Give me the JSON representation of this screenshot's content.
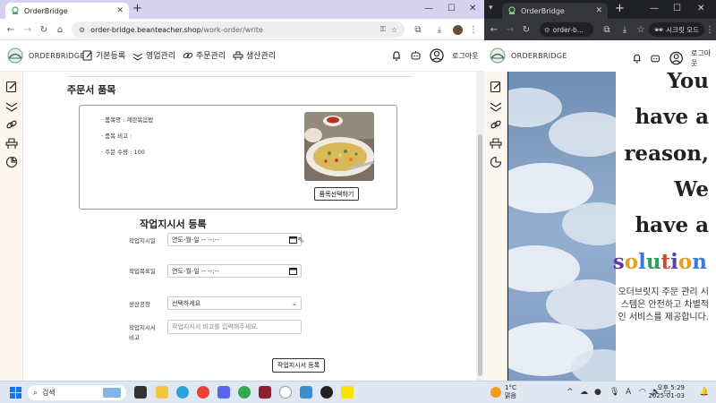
{
  "left_browser": {
    "tab_title": "OrderBridge",
    "url_host": "order-bridge.beanteacher.shop",
    "url_path": "/work-order/write"
  },
  "app": {
    "brand": "ORDERBRIDGE",
    "nav": [
      {
        "label": "기본등록",
        "icon": "edit-icon"
      },
      {
        "label": "영업관리",
        "icon": "handshake-icon"
      },
      {
        "label": "주문관리",
        "icon": "link-icon"
      },
      {
        "label": "생산관리",
        "icon": "factory-icon"
      }
    ],
    "logout_label": "로그아웃"
  },
  "order_item": {
    "section_title": "주문서 품목",
    "product_name_line": "· 품목명 : 계란볶음밥",
    "product_note_line": "· 품목 비고 :",
    "quantity_line": "· 주문 수량 : 100",
    "select_button": "품목선택하기"
  },
  "work_order_form": {
    "title": "작업지시서 등록",
    "start_label": "작업지시일",
    "start_placeholder": "연도-월-일 -- --:--",
    "target_label": "작업목표일",
    "target_placeholder": "연도-월-일 -- --:--",
    "factory_label": "생산공장",
    "factory_selected": "선택하세요",
    "note_label": "작업지시서 비고",
    "note_placeholder": "작업지시서 비고를 입력해주세요.",
    "submit_button": "작업지시서 등록"
  },
  "right_browser": {
    "tab_title": "OrderBridge",
    "url_short": "order-b...",
    "secret_mode": "시크릿 모드",
    "brand": "ORDERBRIDGE",
    "logout_label": "로그아웃"
  },
  "slogan": {
    "lines": [
      "You",
      "have a",
      "reason,",
      "We",
      "have a"
    ],
    "last_word_letters": [
      "s",
      "o",
      "l",
      "u",
      "t",
      "i",
      "o",
      "n"
    ],
    "last_word_colors": [
      "#5b3fa0",
      "#e0a21c",
      "#3a7bd5",
      "#2f9e5a",
      "#d2452f",
      "#5b3fa0",
      "#e0a21c",
      "#3a7bd5"
    ],
    "description": "오더브릿지 주문 관리 시스템은 안전하고 차별적인 서비스를 제공합니다."
  },
  "taskbar": {
    "search_label": "검색",
    "weather_temp": "1°C",
    "weather_desc": "맑음",
    "time": "오후 5:29",
    "date": "2025-01-03"
  }
}
